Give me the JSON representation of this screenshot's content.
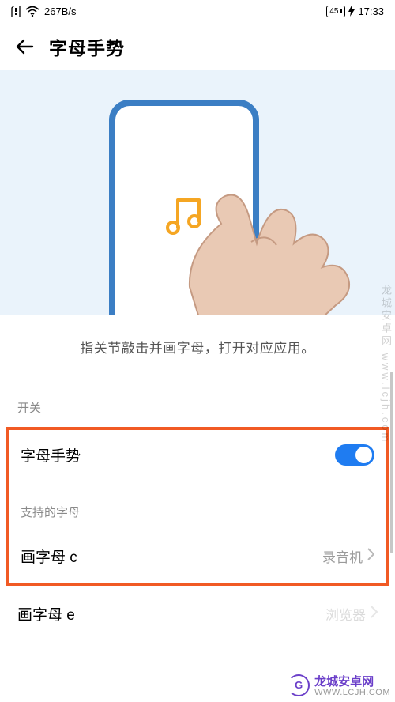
{
  "status": {
    "net_speed": "267B/s",
    "battery_text": "45",
    "time": "17:33"
  },
  "header": {
    "title": "字母手势"
  },
  "hero": {
    "caption": "指关节敲击并画字母，打开对应应用。"
  },
  "sections": {
    "switch_header": "开关",
    "supported_header": "支持的字母"
  },
  "rows": {
    "toggle_label": "字母手势",
    "toggle_on": true,
    "c_label": "画字母 c",
    "c_value": "录音机",
    "e_label": "画字母 e",
    "e_value": "浏览器"
  },
  "watermark": {
    "vertical": "龙城安卓网 www.lcjh.com",
    "brand": "龙城安卓网",
    "url": "WWW.LCJH.COM"
  }
}
